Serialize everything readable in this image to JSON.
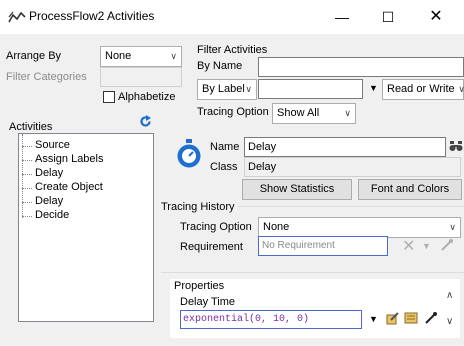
{
  "window": {
    "title": "ProcessFlow2 Activities",
    "minimize": "—",
    "maximize": "☐",
    "close": "✕"
  },
  "left": {
    "arrange_by_label": "Arrange By",
    "arrange_by_value": "None",
    "filter_categories_label": "Filter Categories",
    "alphabetize_label": "Alphabetize",
    "activities_label": "Activities",
    "activities": [
      "Source",
      "Assign Labels",
      "Delay",
      "Create Object",
      "Delay",
      "Decide"
    ]
  },
  "filter": {
    "header": "Filter Activities",
    "by_name_label": "By Name",
    "by_label_value": "By Label",
    "read_write_value": "Read or Write",
    "tracing_option_label": "Tracing Option",
    "tracing_option_value": "Show All"
  },
  "activity": {
    "name_label": "Name",
    "name_value": "Delay",
    "class_label": "Class",
    "class_value": "Delay",
    "show_statistics": "Show Statistics",
    "font_and_colors": "Font and Colors"
  },
  "tracing_history": {
    "header": "Tracing History",
    "tracing_option_label": "Tracing Option",
    "tracing_option_value": "None",
    "requirement_label": "Requirement",
    "requirement_placeholder": "No Requirement"
  },
  "properties": {
    "header": "Properties",
    "delay_time_label": "Delay Time",
    "delay_time_value": "exponential(0, 10, 0)"
  },
  "colors": {
    "accent_blue": "#1e6fd0",
    "field_focus_border": "#4a6ad0",
    "code_purple": "#7a2da8",
    "refresh_icon": "#1e6fd0"
  },
  "icons": [
    "processflow-icon",
    "refresh-icon",
    "stopwatch-icon",
    "binoculars-icon",
    "clear-icon",
    "dropdown-icon",
    "eyedropper-icon",
    "edit-icon",
    "code-icon"
  ]
}
